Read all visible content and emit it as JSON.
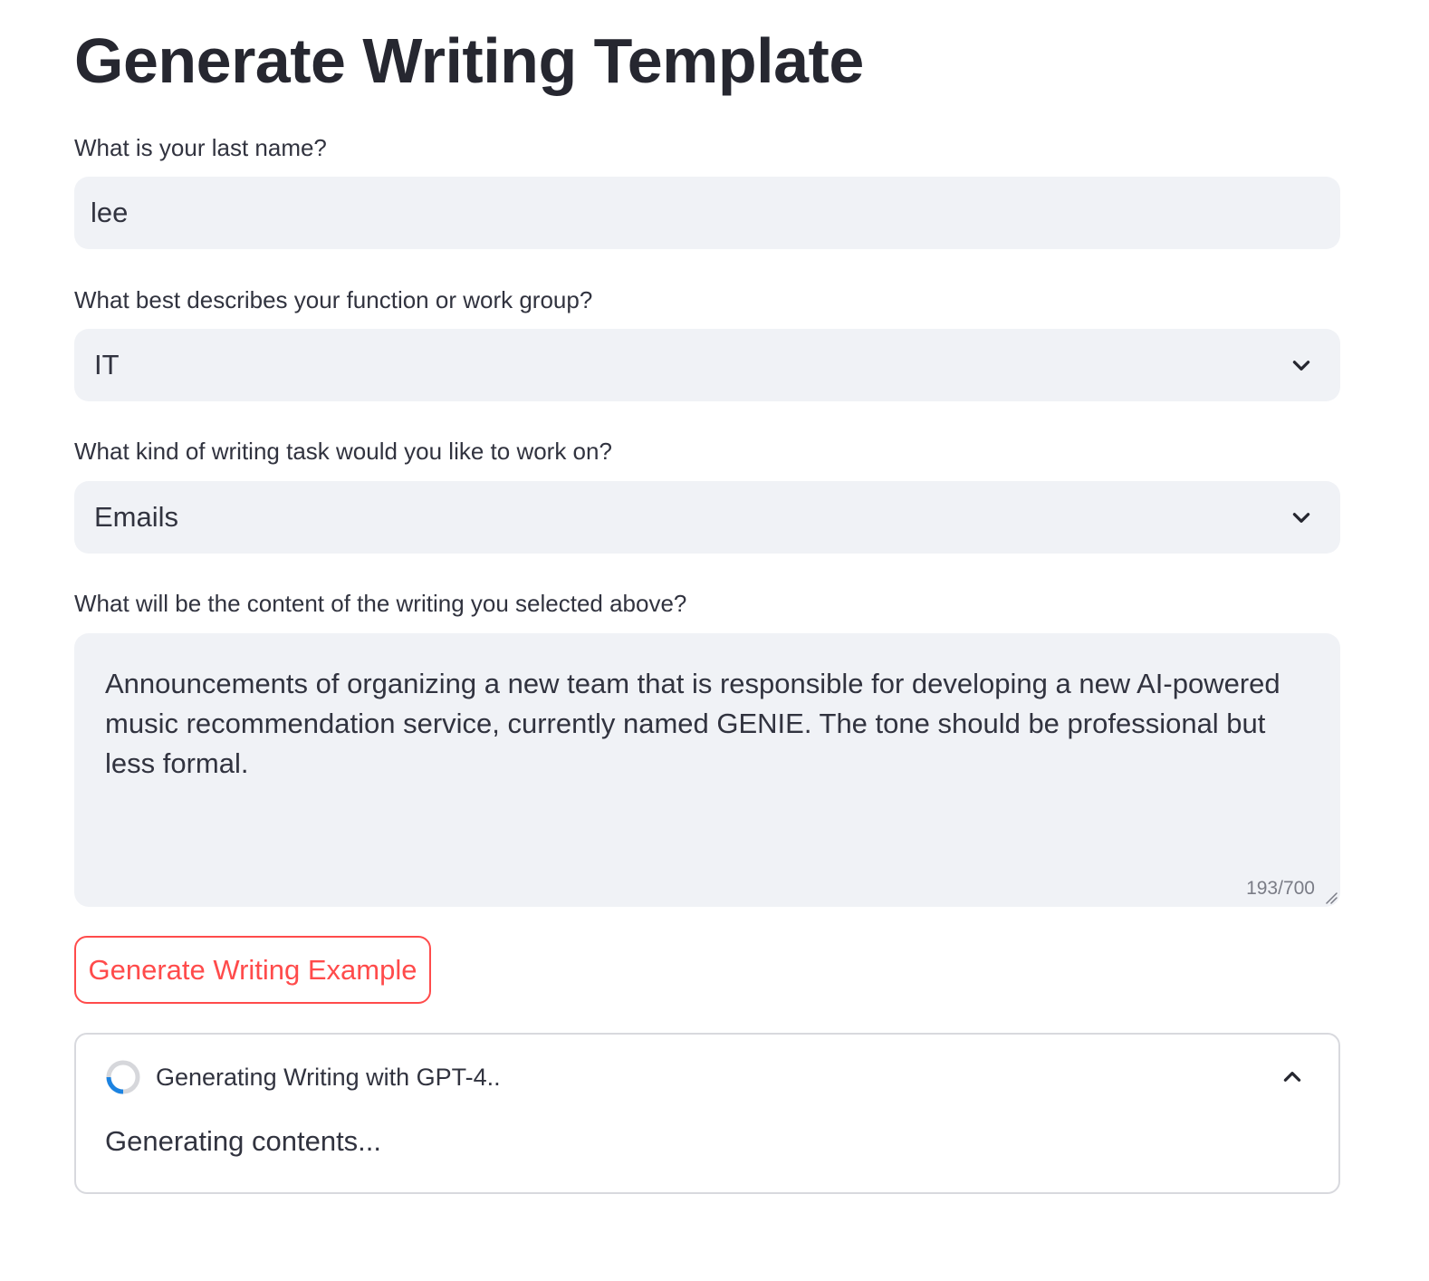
{
  "page": {
    "title": "Generate Writing Template"
  },
  "form": {
    "last_name": {
      "label": "What is your last name?",
      "value": "lee"
    },
    "function_group": {
      "label": "What best describes your function or work group?",
      "selected": "IT",
      "icon": "chevron-down-icon"
    },
    "writing_task": {
      "label": "What kind of writing task would you like to work on?",
      "selected": "Emails",
      "icon": "chevron-down-icon"
    },
    "content": {
      "label": "What will be the content of the writing you selected above?",
      "value": "Announcements of organizing a new team that is responsible for developing a new AI-powered music recommendation service, currently named GENIE. The tone should be professional but less formal.",
      "counter": "193/700"
    }
  },
  "actions": {
    "generate_label": "Generate Writing Example"
  },
  "status": {
    "title": "Generating Writing with GPT-4..",
    "body": "Generating contents...",
    "icon": "spinner-icon",
    "collapse_icon": "chevron-up-icon"
  },
  "colors": {
    "accent": "#ff4b4b",
    "field_bg": "#f0f2f6",
    "text": "#31333f",
    "spinner": "#1c83e1"
  }
}
